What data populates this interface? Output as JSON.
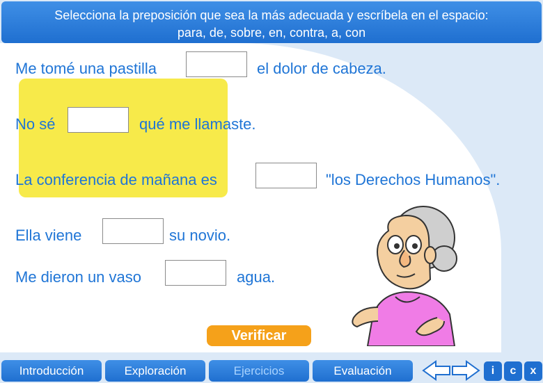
{
  "header": {
    "line1": "Selecciona la preposición que sea la más adecuada y escríbela en el espacio:",
    "line2": "para, de, sobre, en, contra, a, con"
  },
  "exercise": {
    "s1": {
      "before": "Me tomé una pastilla",
      "after": "el dolor de cabeza.",
      "value": ""
    },
    "s2": {
      "before": "No sé",
      "after": "qué me llamaste.",
      "value": ""
    },
    "s3": {
      "before": "La conferencia de mañana es",
      "after": "\"los Derechos Humanos\".",
      "value": ""
    },
    "s4": {
      "before": "Ella viene",
      "after": "su novio.",
      "value": ""
    },
    "s5": {
      "before": "Me dieron un vaso",
      "after": "agua.",
      "value": ""
    }
  },
  "verify_label": "Verificar",
  "nav": {
    "intro": "Introducción",
    "exploracion": "Exploración",
    "ejercicios": "Ejercicios",
    "evaluacion": "Evaluación",
    "info": "i",
    "credits": "c",
    "close": "x"
  },
  "colors": {
    "accent_blue": "#1f6fd0",
    "text_blue": "#1f75d6",
    "highlight_yellow": "#f7ea4a",
    "verify_orange": "#f5a11a"
  }
}
